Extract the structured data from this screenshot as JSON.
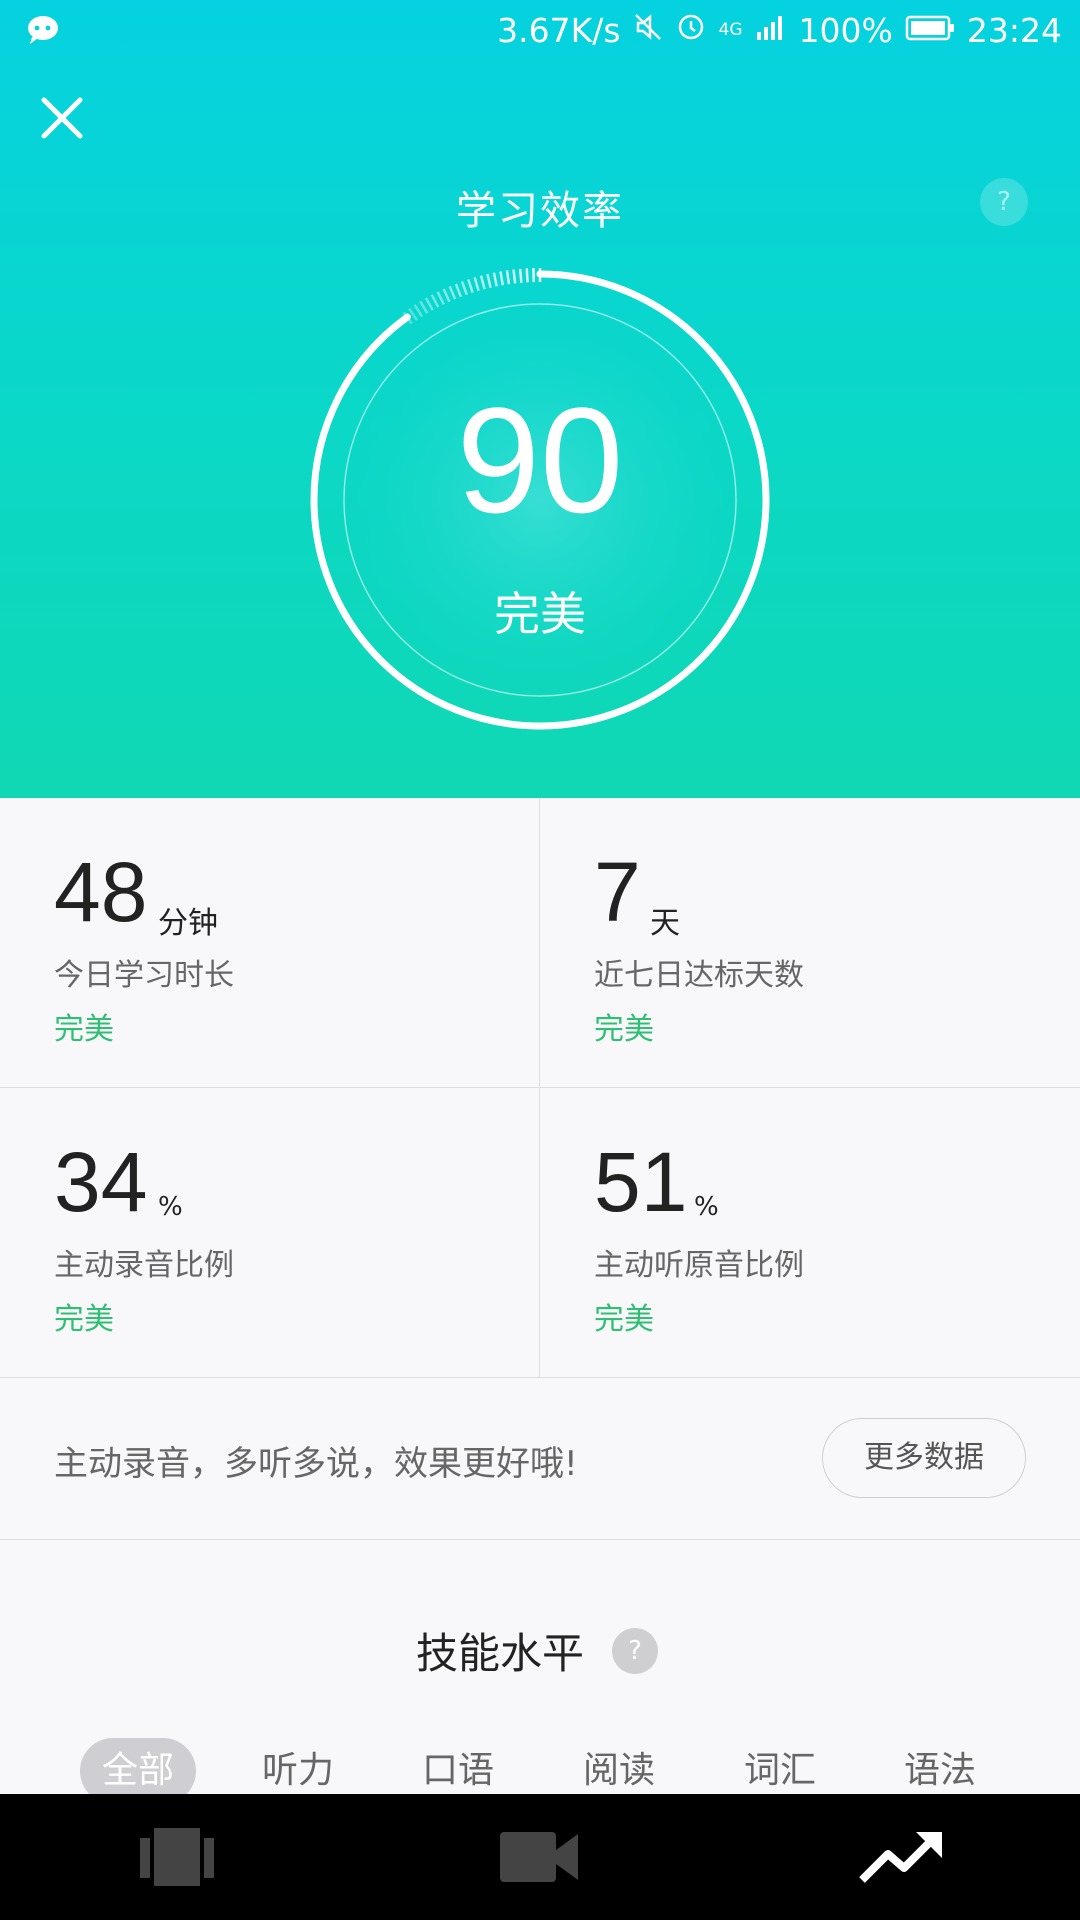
{
  "status_bar": {
    "speed": "3.67K/s",
    "network": "4G",
    "battery": "100%",
    "time": "23:24"
  },
  "header": {
    "title": "学习效率",
    "help": "?"
  },
  "gauge": {
    "score": "90",
    "label": "完美"
  },
  "stats": [
    {
      "value": "48",
      "unit": "分钟",
      "desc": "今日学习时长",
      "rating": "完美"
    },
    {
      "value": "7",
      "unit": "天",
      "desc": "近七日达标天数",
      "rating": "完美"
    },
    {
      "value": "34",
      "unit": "%",
      "desc": "主动录音比例",
      "rating": "完美"
    },
    {
      "value": "51",
      "unit": "%",
      "desc": "主动听原音比例",
      "rating": "完美"
    }
  ],
  "tip": {
    "text": "主动录音，多听多说，效果更好哦!",
    "more_button": "更多数据"
  },
  "skills": {
    "title": "技能水平",
    "help": "?",
    "tabs": [
      "全部",
      "听力",
      "口语",
      "阅读",
      "词汇",
      "语法"
    ],
    "active_tab": "全部"
  },
  "colors": {
    "hero_top": "#05d2e0",
    "hero_bottom": "#10d8b4",
    "rating_green": "#2fbf73"
  },
  "nav_icons": [
    "cards-icon",
    "video-icon",
    "trending-up-icon"
  ]
}
